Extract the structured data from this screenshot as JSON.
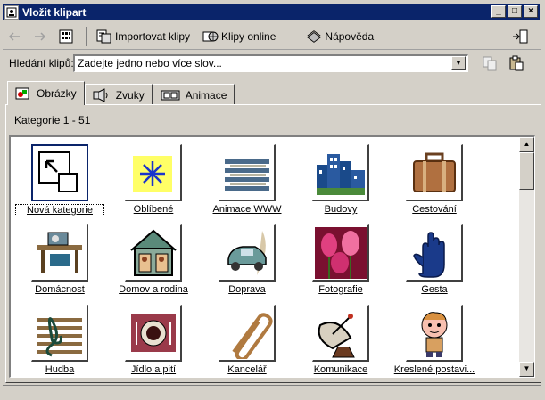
{
  "window": {
    "title": "Vložit klipart"
  },
  "window_buttons": [
    "_",
    "□",
    "×"
  ],
  "toolbar": {
    "import_label": "Importovat klipy",
    "online_label": "Klipy online",
    "help_label": "Nápověda"
  },
  "search": {
    "label": "Hledání klipů:",
    "value": "Zadejte jedno nebo více slov..."
  },
  "tabs": [
    {
      "label": "Obrázky"
    },
    {
      "label": "Zvuky"
    },
    {
      "label": "Animace"
    }
  ],
  "category_count": "Kategorie 1 - 51",
  "categories": [
    {
      "label": "Nová kategorie",
      "icon": "new-category-icon"
    },
    {
      "label": "Oblíbené",
      "icon": "favorites-icon"
    },
    {
      "label": "Animace WWW",
      "icon": "web-animation-icon"
    },
    {
      "label": "Budovy",
      "icon": "buildings-icon"
    },
    {
      "label": "Cestování",
      "icon": "suitcase-icon"
    },
    {
      "label": "Domácnost",
      "icon": "household-icon"
    },
    {
      "label": "Domov a rodina",
      "icon": "family-house-icon"
    },
    {
      "label": "Doprava",
      "icon": "car-icon"
    },
    {
      "label": "Fotografie",
      "icon": "photo-tulips-icon"
    },
    {
      "label": "Gesta",
      "icon": "hand-gesture-icon"
    },
    {
      "label": "Hudba",
      "icon": "music-staff-icon"
    },
    {
      "label": "Jídlo a pití",
      "icon": "plate-icon"
    },
    {
      "label": "Kancelář",
      "icon": "paperclip-icon"
    },
    {
      "label": "Komunikace",
      "icon": "satellite-dish-icon"
    },
    {
      "label": "Kreslené postavi...",
      "icon": "cartoon-character-icon"
    }
  ],
  "colors": {
    "titlebar": "#0a246a",
    "face": "#d4d0c8"
  }
}
